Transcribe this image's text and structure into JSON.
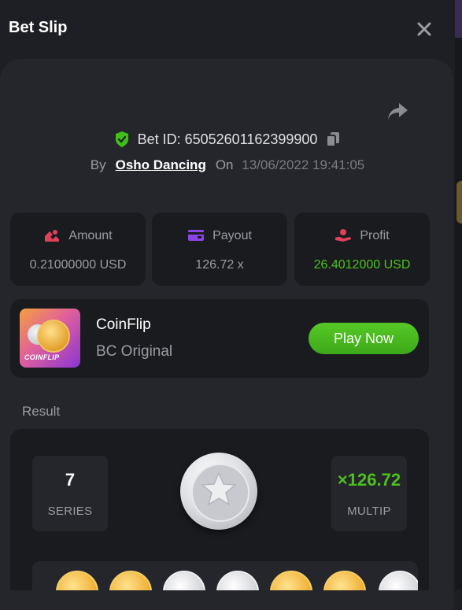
{
  "header": {
    "title": "Bet Slip",
    "close_icon": "close-icon"
  },
  "bet": {
    "id_label": "Bet ID: 65052601162399900",
    "by_label": "By",
    "user": "Osho Dancing",
    "on_label": "On",
    "datetime": "13/06/2022 19:41:05"
  },
  "stats": [
    {
      "label": "Amount",
      "value": "0.21000000 USD",
      "icon": "amount-icon",
      "icon_color": "#e0405a",
      "value_color": "#9a9ca3"
    },
    {
      "label": "Payout",
      "value": "126.72 x",
      "icon": "payout-icon",
      "icon_color": "#8a45e6",
      "value_color": "#9a9ca3"
    },
    {
      "label": "Profit",
      "value": "26.4012000 USD",
      "icon": "profit-icon",
      "icon_color": "#e0405a",
      "value_color": "#4cc21b"
    }
  ],
  "game": {
    "name": "CoinFlip",
    "subtitle": "BC Original",
    "thumb_label": "COINFLIP",
    "play_label": "Play Now"
  },
  "result": {
    "label": "Result",
    "series_value": "7",
    "series_label": "SERIES",
    "multiplier_value": "×126.72",
    "multiplier_label": "MULTIP",
    "main_coin": "silver",
    "coin_series": [
      "gold",
      "gold",
      "silver",
      "silver",
      "gold",
      "gold",
      "silver"
    ]
  },
  "colors": {
    "accent_green": "#4cc21b",
    "background": "#1e1f24",
    "card": "#25262b",
    "panel": "#1a1b1f"
  }
}
